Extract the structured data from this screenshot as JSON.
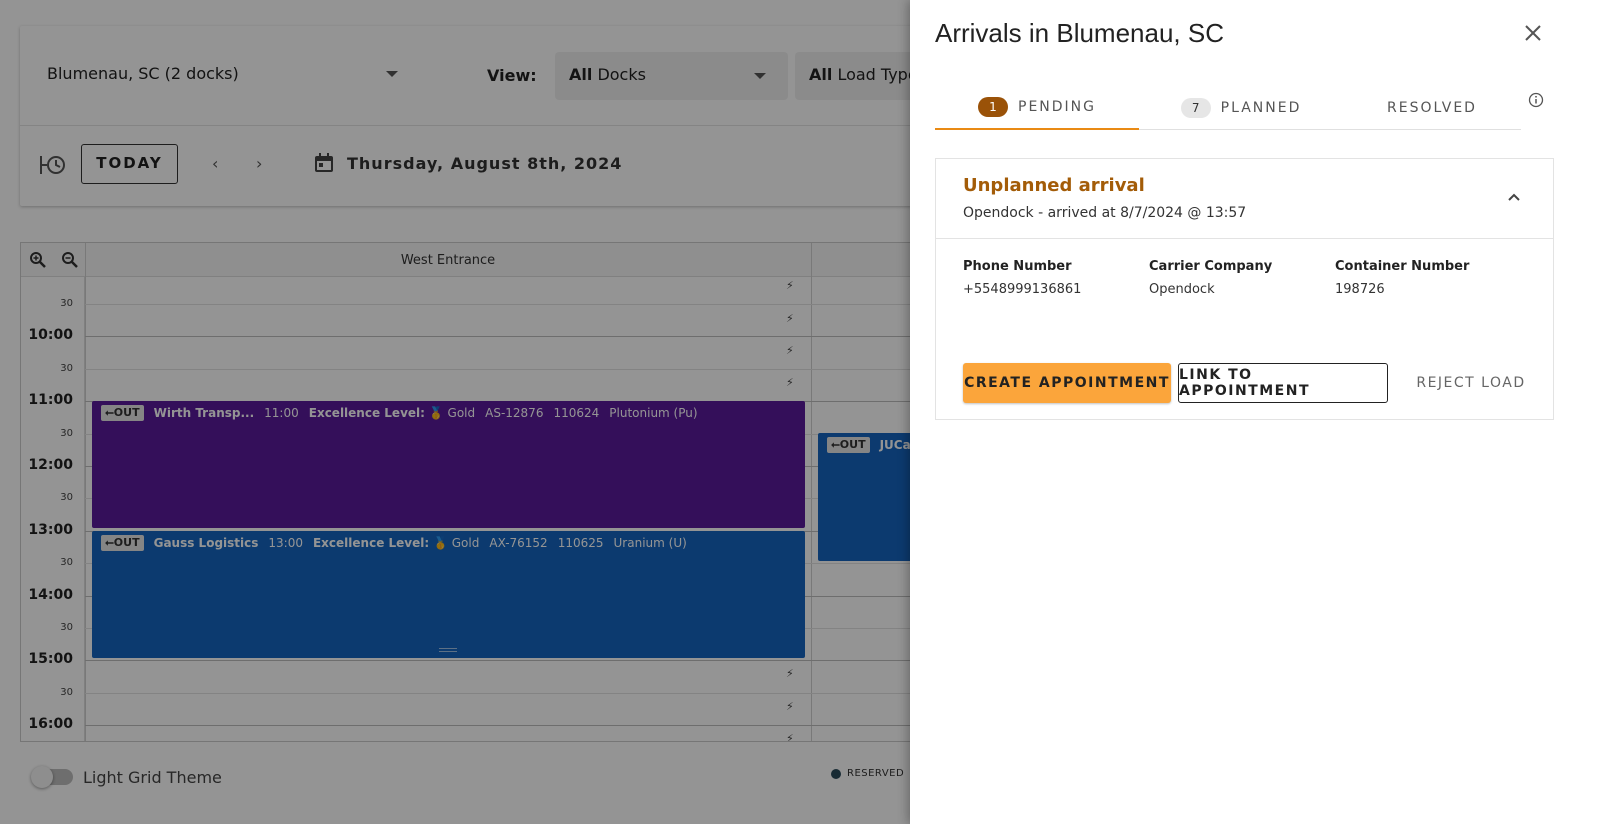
{
  "background": {
    "warehouse_select": "Blumenau, SC (2 docks)",
    "view_label": "View:",
    "docks_select": {
      "bold": "All",
      "rest": " Docks"
    },
    "loads_select": {
      "bold": "All",
      "rest": " Load Types"
    },
    "today_button": "TODAY",
    "prev_icon": "‹",
    "next_icon": "›",
    "date": "Thursday, August 8th, 2024",
    "columns": [
      "West Entrance"
    ],
    "times": [
      {
        "label": "30",
        "major": false
      },
      {
        "label": "10:00",
        "major": true
      },
      {
        "label": "30",
        "major": false
      },
      {
        "label": "11:00",
        "major": true
      },
      {
        "label": "30",
        "major": false
      },
      {
        "label": "12:00",
        "major": true
      },
      {
        "label": "30",
        "major": false
      },
      {
        "label": "13:00",
        "major": true
      },
      {
        "label": "30",
        "major": false
      },
      {
        "label": "14:00",
        "major": true
      },
      {
        "label": "30",
        "major": false
      },
      {
        "label": "15:00",
        "major": true
      },
      {
        "label": "30",
        "major": false
      },
      {
        "label": "16:00",
        "major": true
      }
    ],
    "appointments": [
      {
        "tag": "⭠OUT",
        "carrier": "Wirth Transp...",
        "time": "11:00",
        "excellence_label": "Excellence Level:",
        "excellence_value": "🥇 Gold",
        "ref": "AS-12876",
        "id": "110624",
        "load": "Plutonium (Pu)"
      },
      {
        "tag": "⭠OUT",
        "carrier": "Gauss Logistics",
        "time": "13:00",
        "excellence_label": "Excellence Level:",
        "excellence_value": "🥇 Gold",
        "ref": "AX-76152",
        "id": "110625",
        "load": "Uranium (U)"
      },
      {
        "tag": "⭠OUT",
        "carrier": "JUCa"
      }
    ],
    "theme_toggle_label": "Light Grid Theme",
    "legend_reserved": "RESERVED"
  },
  "drawer": {
    "title": "Arrivals in Blumenau, SC",
    "tabs": [
      {
        "count": "1",
        "label": "PENDING",
        "active": true
      },
      {
        "count": "7",
        "label": "PLANNED",
        "active": false
      },
      {
        "count": "",
        "label": "RESOLVED",
        "active": false
      }
    ],
    "card": {
      "title": "Unplanned arrival",
      "subtitle": "Opendock - arrived at 8/7/2024 @ 13:57",
      "fields": [
        {
          "label": "Phone Number",
          "value": "+5548999136861"
        },
        {
          "label": "Carrier Company",
          "value": "Opendock"
        },
        {
          "label": "Container Number",
          "value": "198726"
        }
      ],
      "buttons": {
        "create": "CREATE APPOINTMENT",
        "link": "LINK TO APPOINTMENT",
        "reject": "REJECT LOAD"
      }
    }
  },
  "colors": {
    "accent": "#e98a14",
    "arrival_title": "#a35c08",
    "create_button": "#fba53b",
    "purple_appt": "#5a1a9c",
    "blue_appt": "#1565c0"
  }
}
